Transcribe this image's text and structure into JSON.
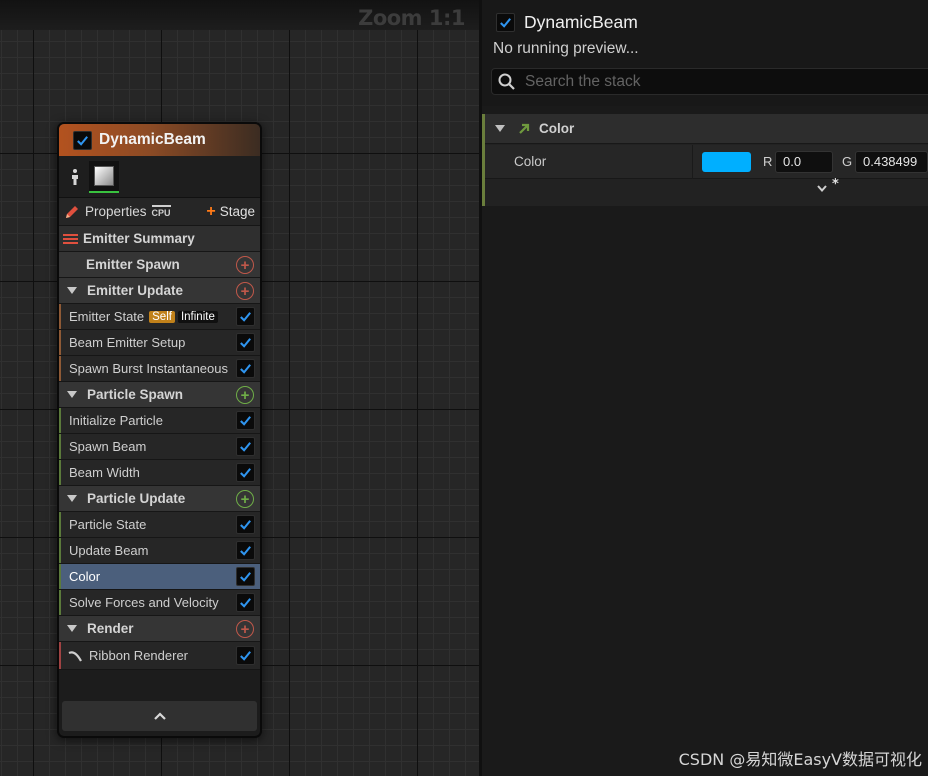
{
  "graph": {
    "zoom_label": "Zoom 1:1"
  },
  "node": {
    "title": "DynamicBeam",
    "enabled": true,
    "properties_label": "Properties",
    "sim_target": "CPU",
    "stage_label": "Stage",
    "summary_label": "Emitter Summary",
    "sections": [
      {
        "label": "Emitter Spawn",
        "collapsible": false,
        "modules": []
      },
      {
        "label": "Emitter Update",
        "collapsible": true,
        "modules": [
          {
            "label": "Emitter State",
            "badge_self": "Self",
            "badge_lifecycle": "Infinite",
            "enabled": true
          },
          {
            "label": "Beam Emitter Setup",
            "enabled": true
          },
          {
            "label": "Spawn Burst Instantaneous",
            "enabled": true
          }
        ]
      },
      {
        "label": "Particle Spawn",
        "collapsible": true,
        "modules": [
          {
            "label": "Initialize Particle",
            "enabled": true
          },
          {
            "label": "Spawn Beam",
            "enabled": true
          },
          {
            "label": "Beam Width",
            "enabled": true
          }
        ]
      },
      {
        "label": "Particle Update",
        "collapsible": true,
        "modules": [
          {
            "label": "Particle State",
            "enabled": true
          },
          {
            "label": "Update Beam",
            "enabled": true
          },
          {
            "label": "Color",
            "enabled": true,
            "selected": true
          },
          {
            "label": "Solve Forces and Velocity",
            "enabled": true
          }
        ]
      },
      {
        "label": "Render",
        "collapsible": true,
        "modules": [
          {
            "label": "Ribbon Renderer",
            "enabled": true,
            "icon": "ribbon-renderer-icon"
          }
        ]
      }
    ]
  },
  "panel": {
    "title": "DynamicBeam",
    "preview_status": "No running preview...",
    "search_placeholder": "Search the stack",
    "section_title": "Color",
    "color_row_label": "Color",
    "swatch_color": "#00AFFF",
    "channels": [
      {
        "label": "R",
        "value": "0.0"
      },
      {
        "label": "G",
        "value": "0.438499"
      }
    ],
    "expand_marker": "*"
  },
  "watermark": "CSDN @易知微EasyV数据可视化",
  "colors": {
    "accent_check": "#1e88e5",
    "header_orange": "#b3521f",
    "selected_row": "#4b5f7c",
    "add_spawn_update": "#c0584a",
    "add_particle": "#6fae47"
  }
}
